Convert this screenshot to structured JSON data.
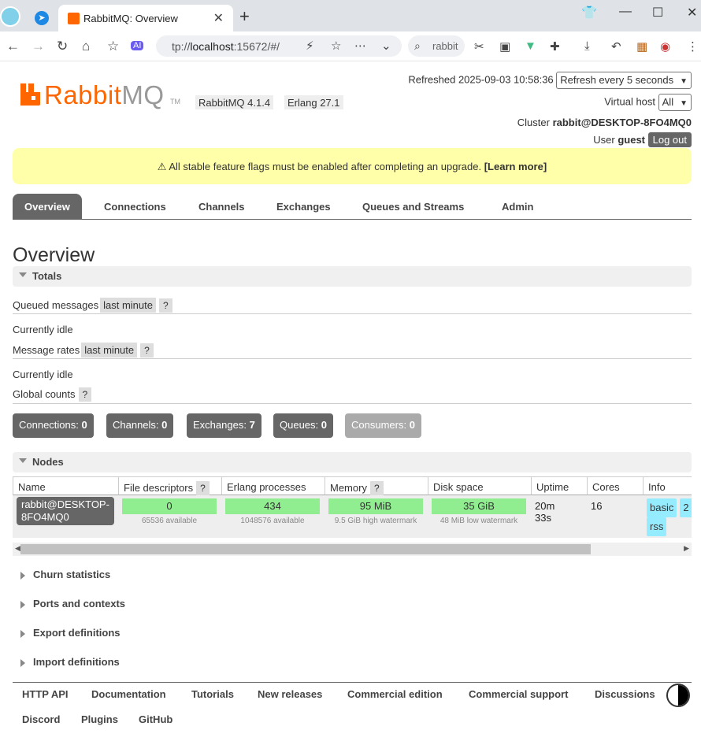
{
  "browser": {
    "tab_title": "RabbitMQ: Overview",
    "url_prefix": "tp://",
    "url_host": "localhost",
    "url_rest": ":15672/#/",
    "search_text": "rabbit"
  },
  "header": {
    "logo_rabbit": "Rabbit",
    "logo_mq": "MQ",
    "logo_tm": "TM",
    "version": "RabbitMQ 4.1.4",
    "erlang": "Erlang 27.1",
    "refreshed_label": "Refreshed 2025-09-03 10:58:36",
    "refresh_select": "Refresh every 5 seconds",
    "vhost_label": "Virtual host",
    "vhost_select": "All",
    "cluster_label": "Cluster",
    "cluster_name": "rabbit@DESKTOP-8FO4MQ0",
    "user_label": "User",
    "user_name": "guest",
    "logout": "Log out"
  },
  "banner": {
    "text": "⚠ All stable feature flags must be enabled after completing an upgrade.",
    "link": "[Learn more]"
  },
  "tabs": [
    "Overview",
    "Connections",
    "Channels",
    "Exchanges",
    "Queues and Streams",
    "Admin"
  ],
  "page_title": "Overview",
  "totals": {
    "label": "Totals",
    "queued_label": "Queued messages",
    "queued_range": "last minute",
    "help": "?",
    "queued_status": "Currently idle",
    "rates_label": "Message rates",
    "rates_range": "last minute",
    "rates_status": "Currently idle",
    "global_label": "Global counts"
  },
  "counts": [
    {
      "label": "Connections:",
      "value": "0"
    },
    {
      "label": "Channels:",
      "value": "0"
    },
    {
      "label": "Exchanges:",
      "value": "7"
    },
    {
      "label": "Queues:",
      "value": "0"
    },
    {
      "label": "Consumers:",
      "value": "0"
    }
  ],
  "nodes": {
    "label": "Nodes",
    "headers": [
      "Name",
      "File descriptors",
      "Erlang processes",
      "Memory",
      "Disk space",
      "Uptime",
      "Cores",
      "Info"
    ],
    "row": {
      "name_line1": "rabbit@DESKTOP-",
      "name_line2": "8FO4MQ0",
      "fd_value": "0",
      "fd_sub": "65536 available",
      "proc_value": "434",
      "proc_sub": "1048576 available",
      "mem_value": "95 MiB",
      "mem_sub": "9.5 GiB high watermark",
      "disk_value": "35 GiB",
      "disk_sub": "48 MiB low watermark",
      "uptime_line1": "20m",
      "uptime_line2": "33s",
      "cores": "16",
      "info_badges": [
        "basic",
        "2",
        "rss"
      ]
    }
  },
  "collapsed_sections": [
    "Churn statistics",
    "Ports and contexts",
    "Export definitions",
    "Import definitions"
  ],
  "footer_links": [
    "HTTP API",
    "Documentation",
    "Tutorials",
    "New releases",
    "Commercial edition",
    "Commercial support",
    "Discussions",
    "Discord",
    "Plugins",
    "GitHub"
  ],
  "colors": {
    "brand": "#ff6600",
    "banner": "#ffffaa",
    "gauge": "#90ee90",
    "info_badge": "#96ecff"
  }
}
